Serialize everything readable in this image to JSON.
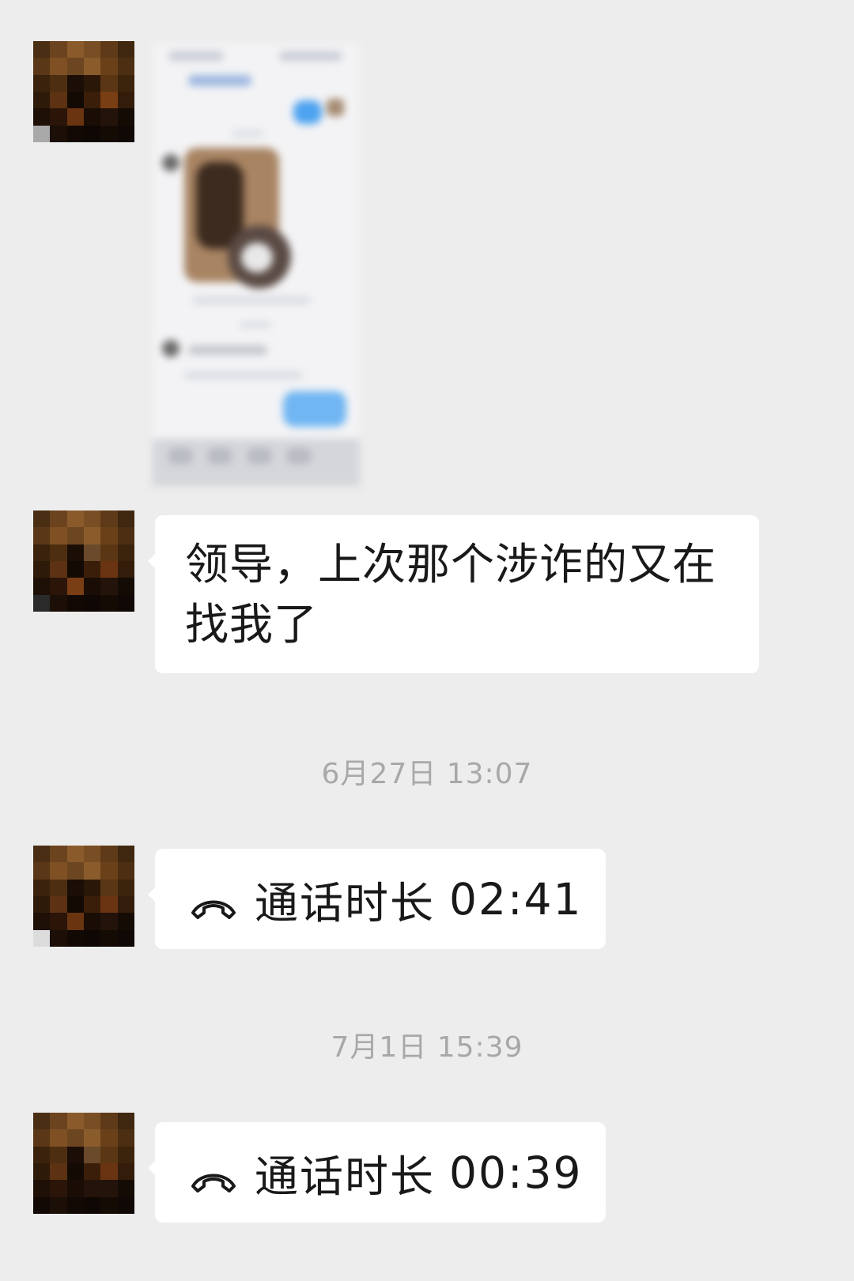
{
  "conversation": {
    "messages": [
      {
        "type": "image",
        "sender": "contact",
        "description_icon": "blurred-chat-screenshot"
      },
      {
        "type": "text",
        "sender": "contact",
        "text": "领导，上次那个涉诈的又在找我了"
      },
      {
        "type": "timestamp",
        "text": "6月27日 13:07"
      },
      {
        "type": "call",
        "sender": "contact",
        "label": "通话时长",
        "duration": "02:41",
        "icon": "phone-hangup-icon"
      },
      {
        "type": "timestamp",
        "text": "7月1日 15:39"
      },
      {
        "type": "call",
        "sender": "contact",
        "label": "通话时长",
        "duration": "00:39",
        "icon": "phone-hangup-icon"
      }
    ]
  },
  "colors": {
    "background": "#EDEDED",
    "bubble": "#FFFFFF",
    "text": "#191919",
    "timestamp": "#A8A8A8"
  }
}
